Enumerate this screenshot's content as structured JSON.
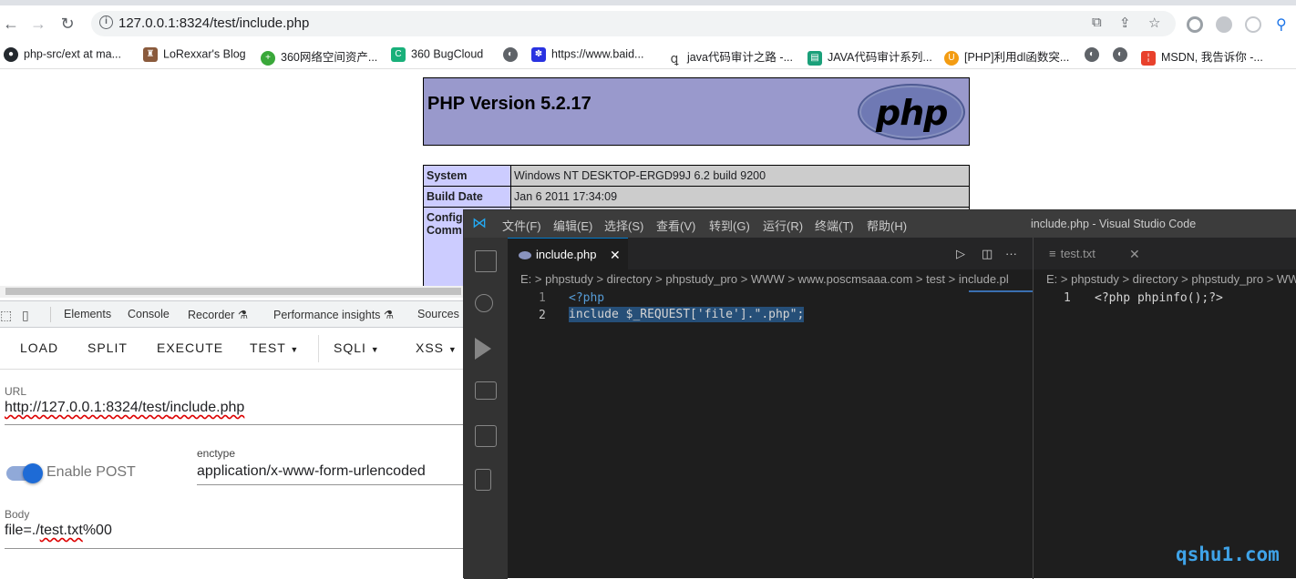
{
  "browser": {
    "url": "127.0.0.1:8324/test/include.php",
    "bookmarks": [
      {
        "label": "php-src/ext at ma...",
        "icon": "github-icon",
        "color": "#24292e"
      },
      {
        "label": "LoRexxar's Blog",
        "icon": "blog-icon",
        "color": "#8a5a3c"
      },
      {
        "label": "360网络空间资产...",
        "icon": "360-icon",
        "color": "#3aa83a"
      },
      {
        "label": "360 BugCloud",
        "icon": "bugcloud-icon",
        "color": "#19b07a"
      },
      {
        "label": "",
        "icon": "globe-icon",
        "color": "#5f6368"
      },
      {
        "label": "https://www.baid...",
        "icon": "baidu-icon",
        "color": "#2932e1"
      },
      {
        "label": "java代码审计之路 -...",
        "icon": "tool-icon",
        "color": "#444444"
      },
      {
        "label": "JAVA代码审计系列...",
        "icon": "doc-icon",
        "color": "#1aa07a"
      },
      {
        "label": "[PHP]利用dl函数突...",
        "icon": "blog-icon",
        "color": "#f39c12"
      },
      {
        "label": "",
        "icon": "globe-icon",
        "color": "#5f6368"
      },
      {
        "label": "",
        "icon": "globe-icon",
        "color": "#5f6368"
      },
      {
        "label": "MSDN, 我告诉你 -...",
        "icon": "msdn-icon",
        "color": "#e8412c"
      }
    ]
  },
  "phpinfo": {
    "title": "PHP Version 5.2.17",
    "logo_text": "php",
    "rows": [
      {
        "key": "System",
        "value": "Windows NT DESKTOP-ERGD99J 6.2 build 9200"
      },
      {
        "key": "Build Date",
        "value": "Jan 6 2011 17:34:09"
      },
      {
        "key": "Config",
        "value": ""
      },
      {
        "key": "Comm",
        "value": ""
      }
    ]
  },
  "devtools": {
    "tabs": [
      "Elements",
      "Console",
      "Recorder",
      "Performance insights",
      "Sources"
    ]
  },
  "hackbar": {
    "buttons": [
      "LOAD",
      "SPLIT",
      "EXECUTE",
      "TEST",
      "SQLI",
      "XSS"
    ],
    "url_label": "URL",
    "url_value_prefix": "http://127.0.0.1:8324/test/",
    "url_value_file": "include.php",
    "post_toggle_label": "Enable POST",
    "post_enabled": true,
    "enctype_label": "enctype",
    "enctype_value": "application/x-www-form-urlencoded",
    "body_label": "Body",
    "body_prefix": "file=./",
    "body_file": "test.txt",
    "body_suffix": "%00"
  },
  "vscode": {
    "menu": [
      "文件(F)",
      "编辑(E)",
      "选择(S)",
      "查看(V)",
      "转到(G)",
      "运行(R)",
      "终端(T)",
      "帮助(H)"
    ],
    "window_title": "include.php - Visual Studio Code",
    "left_tab": "include.php",
    "right_tab": "test.txt",
    "left_breadcrumb": "E: > phpstudy > directory > phpstudy_pro > WWW > www.poscmsaaa.com > test > include.pl",
    "right_breadcrumb": "E: > phpstudy > directory > phpstudy_pro > WW",
    "left_code": [
      "<?php",
      "include $_REQUEST['file'].\".php\";"
    ],
    "right_code": [
      "<?php phpinfo();?>"
    ],
    "line_numbers": [
      "1",
      "2"
    ]
  },
  "watermark": "qshu1.com"
}
